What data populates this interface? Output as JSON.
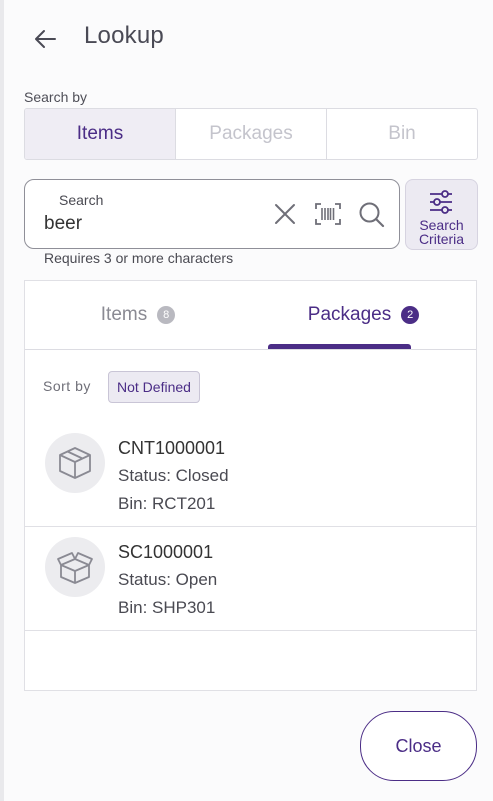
{
  "header": {
    "title": "Lookup",
    "back_icon": "arrow-left-icon"
  },
  "search_by": {
    "label": "Search by",
    "options": [
      "Items",
      "Packages",
      "Bin"
    ],
    "selected": "Items"
  },
  "search": {
    "label": "Search",
    "value": "beer",
    "hint": "Requires 3 or more characters",
    "icons": [
      "close-icon",
      "barcode-icon",
      "search-icon"
    ]
  },
  "criteria_button": {
    "line1": "Search",
    "line2": "Criteria",
    "icon": "sliders-icon"
  },
  "tabs": [
    {
      "label": "Items",
      "count": "8",
      "active": false
    },
    {
      "label": "Packages",
      "count": "2",
      "active": true
    }
  ],
  "sort": {
    "label": "Sort by",
    "value": "Not Defined"
  },
  "results": [
    {
      "id": "CNT1000001",
      "status": "Status: Closed",
      "bin": "Bin: RCT201",
      "icon": "closed-box-icon"
    },
    {
      "id": "SC1000001",
      "status": "Status: Open",
      "bin": "Bin: SHP301",
      "icon": "open-box-icon"
    }
  ],
  "footer": {
    "close_label": "Close"
  },
  "colors": {
    "accent": "#4b2d86",
    "accent_light": "#eceaf2",
    "border": "#dcdce2"
  }
}
